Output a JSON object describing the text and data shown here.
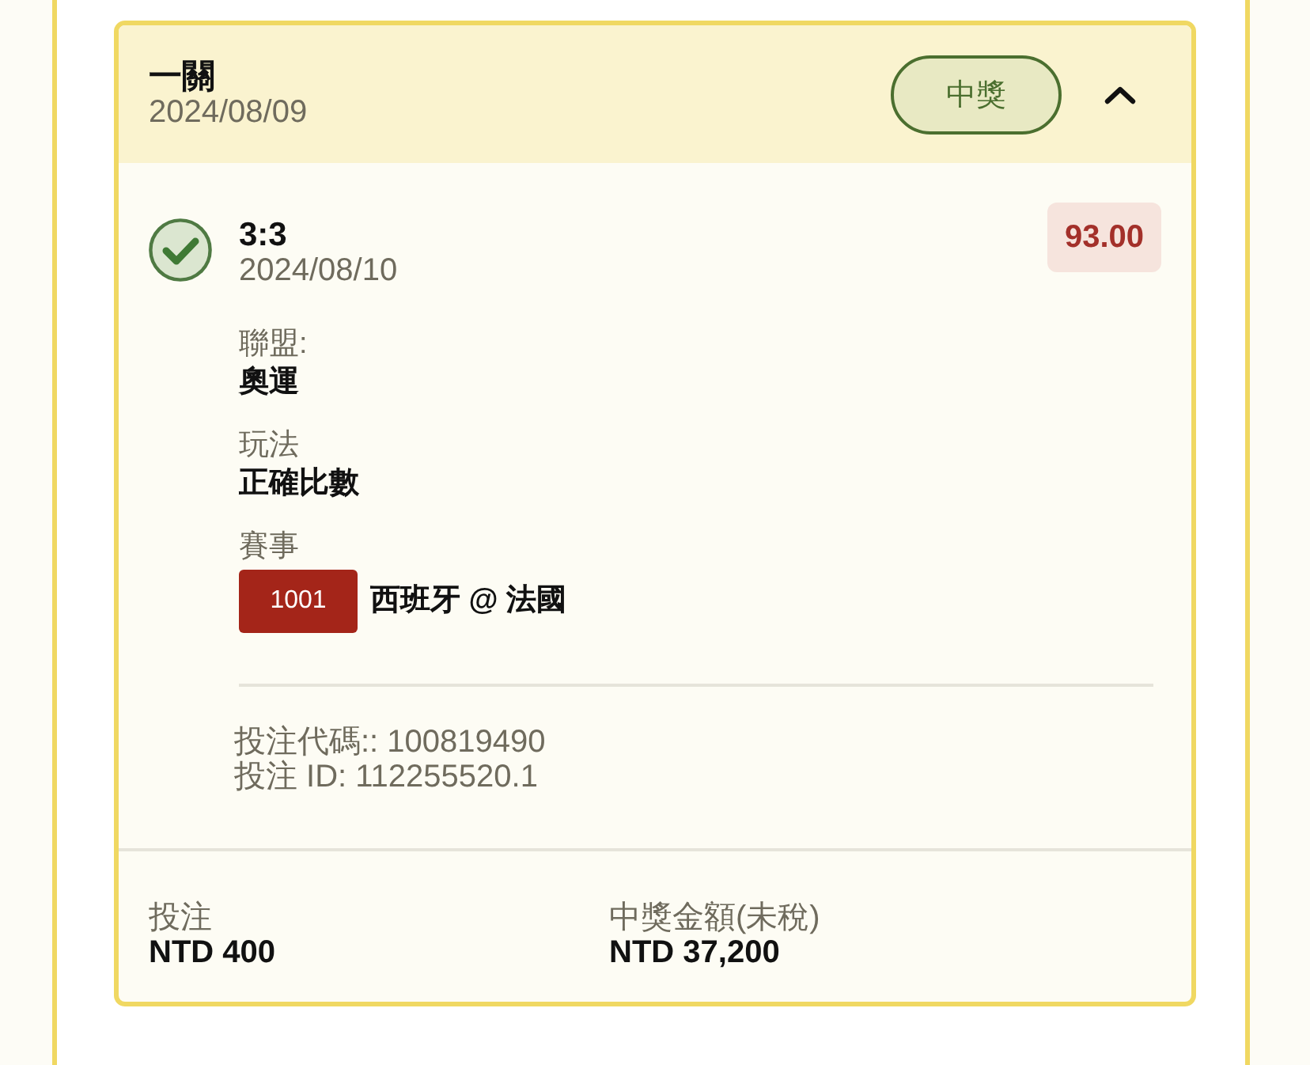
{
  "bet": {
    "title": "一關",
    "date": "2024/08/09",
    "status": {
      "label": "中獎",
      "kind": "won"
    },
    "expanded": true
  },
  "selections": [
    {
      "won": true,
      "score": "3:3",
      "date": "2024/08/10",
      "odds": "93.00",
      "fields": [
        {
          "label": "聯盟:",
          "value": "奧運"
        },
        {
          "label": "玩法",
          "value": "正確比數"
        }
      ],
      "event": {
        "label": "賽事",
        "code": "1001",
        "name": "西班牙 @ 法國"
      }
    }
  ],
  "references": [
    "投注代碼:: 100819490",
    "投注 ID: 112255520.1"
  ],
  "summary": [
    {
      "label": "投注",
      "value": "NTD 400"
    },
    {
      "label": "中獎金額(未稅)",
      "value": "NTD 37,200"
    }
  ]
}
